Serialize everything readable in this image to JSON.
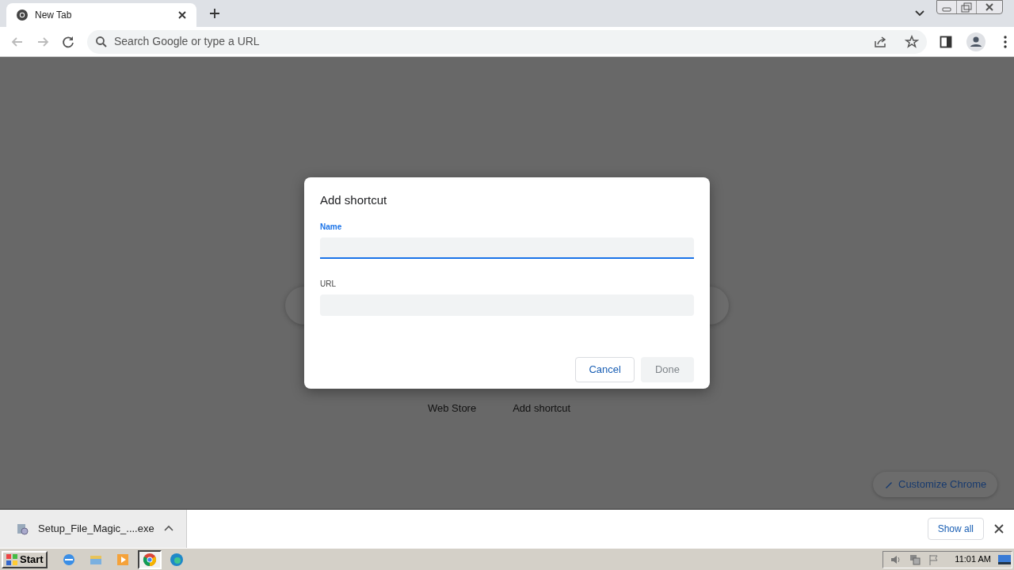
{
  "tabs": [
    {
      "title": "New Tab",
      "selected": true
    }
  ],
  "omnibox": {
    "placeholder": "Search Google or type a URL"
  },
  "new_tab_page": {
    "shortcuts": [
      {
        "label": "Web Store"
      },
      {
        "label": "Add shortcut"
      }
    ],
    "customize_button": "Customize Chrome"
  },
  "dialog": {
    "title": "Add shortcut",
    "fields": [
      {
        "label": "Name",
        "focused": true
      },
      {
        "label": "URL",
        "focused": false
      }
    ],
    "buttons": [
      {
        "label": "Cancel",
        "disabled": false
      },
      {
        "label": "Done",
        "disabled": true
      }
    ]
  },
  "download_bar": {
    "items": [
      {
        "filename": "Setup_File_Magic_....exe"
      }
    ],
    "show_all": "Show all"
  },
  "taskbar": {
    "start": "Start",
    "apps": [
      {
        "kind": "ie",
        "selected": false
      },
      {
        "kind": "explorer",
        "selected": false
      },
      {
        "kind": "media",
        "selected": false
      },
      {
        "kind": "chrome",
        "selected": true
      },
      {
        "kind": "edge",
        "selected": false
      }
    ],
    "clock": "11:01 AM"
  }
}
